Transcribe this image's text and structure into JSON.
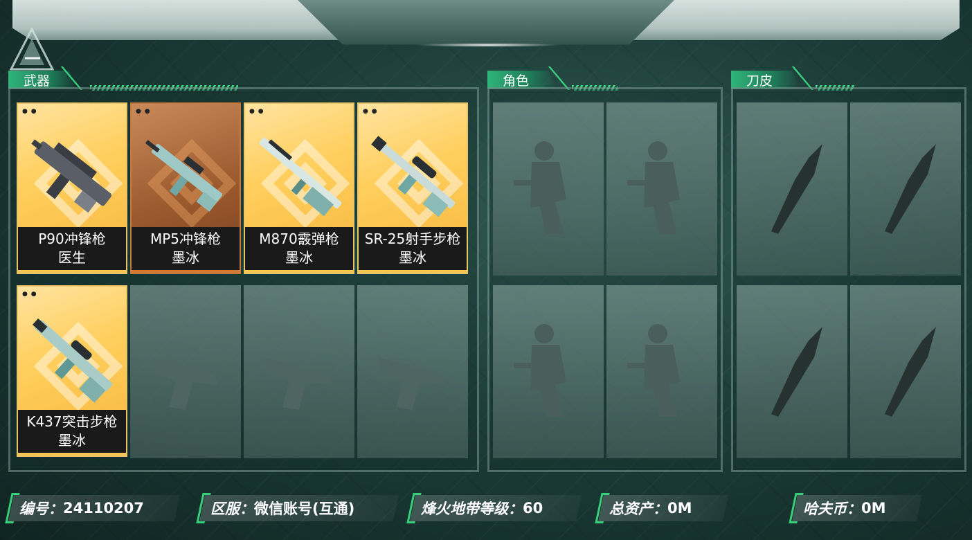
{
  "sections": {
    "weapons": "武器",
    "roles": "角色",
    "knives": "刀皮"
  },
  "weapons": [
    {
      "name": "P90冲锋枪",
      "skin": "医生",
      "rarity": "gold",
      "icon": "smg-icon"
    },
    {
      "name": "MP5冲锋枪",
      "skin": "墨冰",
      "rarity": "bronze",
      "icon": "smg-icon"
    },
    {
      "name": "M870霰弹枪",
      "skin": "墨冰",
      "rarity": "gold",
      "icon": "shotgun-icon"
    },
    {
      "name": "SR-25射手步枪",
      "skin": "墨冰",
      "rarity": "gold",
      "icon": "rifle-icon"
    },
    {
      "name": "K437突击步枪",
      "skin": "墨冰",
      "rarity": "gold",
      "icon": "rifle-icon"
    }
  ],
  "empty_weapon_slots": 3,
  "role_slots": 4,
  "knife_slots": 4,
  "info_bar": {
    "id_label": "编号：",
    "id_value": "24110207",
    "server_label": "区服：",
    "server_value": "微信账号(互通)",
    "level_label": "烽火地带等级：",
    "level_value": "60",
    "assets_label": "总资产：",
    "assets_value": "0M",
    "coins_label": "哈夫币：",
    "coins_value": "0M"
  },
  "colors": {
    "accent": "#37d07a",
    "gold": "#ffcf5e",
    "bronze": "#9b5a2e",
    "bg": "#1d3d38"
  }
}
